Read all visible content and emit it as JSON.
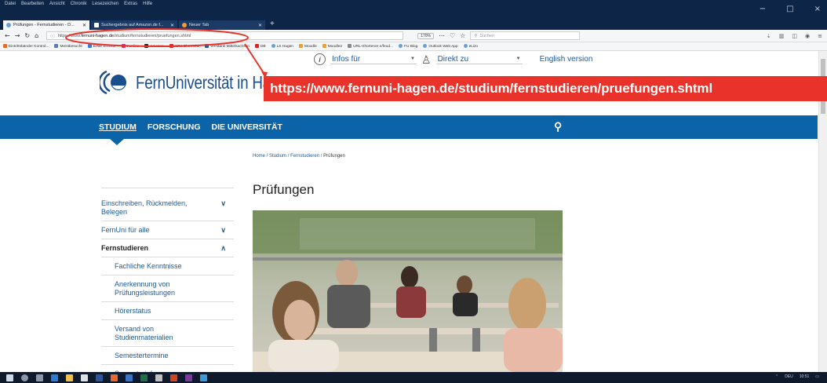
{
  "browser": {
    "menu": [
      "Datei",
      "Bearbeiten",
      "Ansicht",
      "Chronik",
      "Lesezeichen",
      "Extras",
      "Hilfe"
    ],
    "window_controls": [
      "−",
      "□",
      "×"
    ],
    "tabs": [
      {
        "label": "Prüfungen - Fernstudieren - D...",
        "active": true
      },
      {
        "label": "Suchergebnis auf Amazon.de f...",
        "active": false
      },
      {
        "label": "Neuer Tab",
        "active": false
      }
    ],
    "new_tab": "+",
    "url_prefix": "https://www.",
    "url_domain": "fernuni-hagen.de",
    "url_path": "/studium/fernstudieren/pruefungen.shtml",
    "zoom": "170%",
    "search_placeholder": "Suchen",
    "bookmarks": [
      "Eintrittsbänder Kontrol...",
      "Meistbesucht",
      "Erste Schritte",
      "t-online",
      "Amazon",
      "SPK Chemnitz",
      "VR-Bank Mittelsachsen",
      "DB",
      "LS Hagen",
      "Moodle",
      "Moodle2",
      "URL-Shortener e/feud...",
      "FU Blog",
      "Outlook Web App",
      "eLizo"
    ]
  },
  "topnav": {
    "info_label": "Infos für",
    "direkt_label": "Direkt zu",
    "english": "English version"
  },
  "logo": {
    "text": "FernUniversität in Hagen"
  },
  "callout": {
    "url": "https://www.fernuni-hagen.de/studium/fernstudieren/pruefungen.shtml"
  },
  "mainnav": {
    "items": [
      "STUDIUM",
      "FORSCHUNG",
      "DIE UNIVERSITÄT"
    ]
  },
  "breadcrumb": {
    "home": "Home",
    "studium": "Studium",
    "fernstudieren": "Fernstudieren",
    "current": "Prüfungen"
  },
  "page": {
    "title": "Prüfungen"
  },
  "sidenav": {
    "items": [
      {
        "label": "Einschreiben, Rückmelden, Belegen",
        "chevron": "∨"
      },
      {
        "label": "FernUni für alle",
        "chevron": "∨"
      },
      {
        "label": "Fernstudieren",
        "chevron": "∧"
      }
    ],
    "subitems": [
      "Fachliche Kenntnisse",
      "Anerkennung von Prüfungsleistungen",
      "Hörerstatus",
      "Versand von Studienmaterialien",
      "Semestertermine",
      "Semesterinfo"
    ]
  },
  "taskbar": {
    "tray_lang": "DEU",
    "tray_time": "10:51"
  },
  "colors": {
    "navy": "#0d2547",
    "brand_blue": "#0c64a8",
    "callout_red": "#e8322a",
    "link": "#1a5a9a"
  }
}
